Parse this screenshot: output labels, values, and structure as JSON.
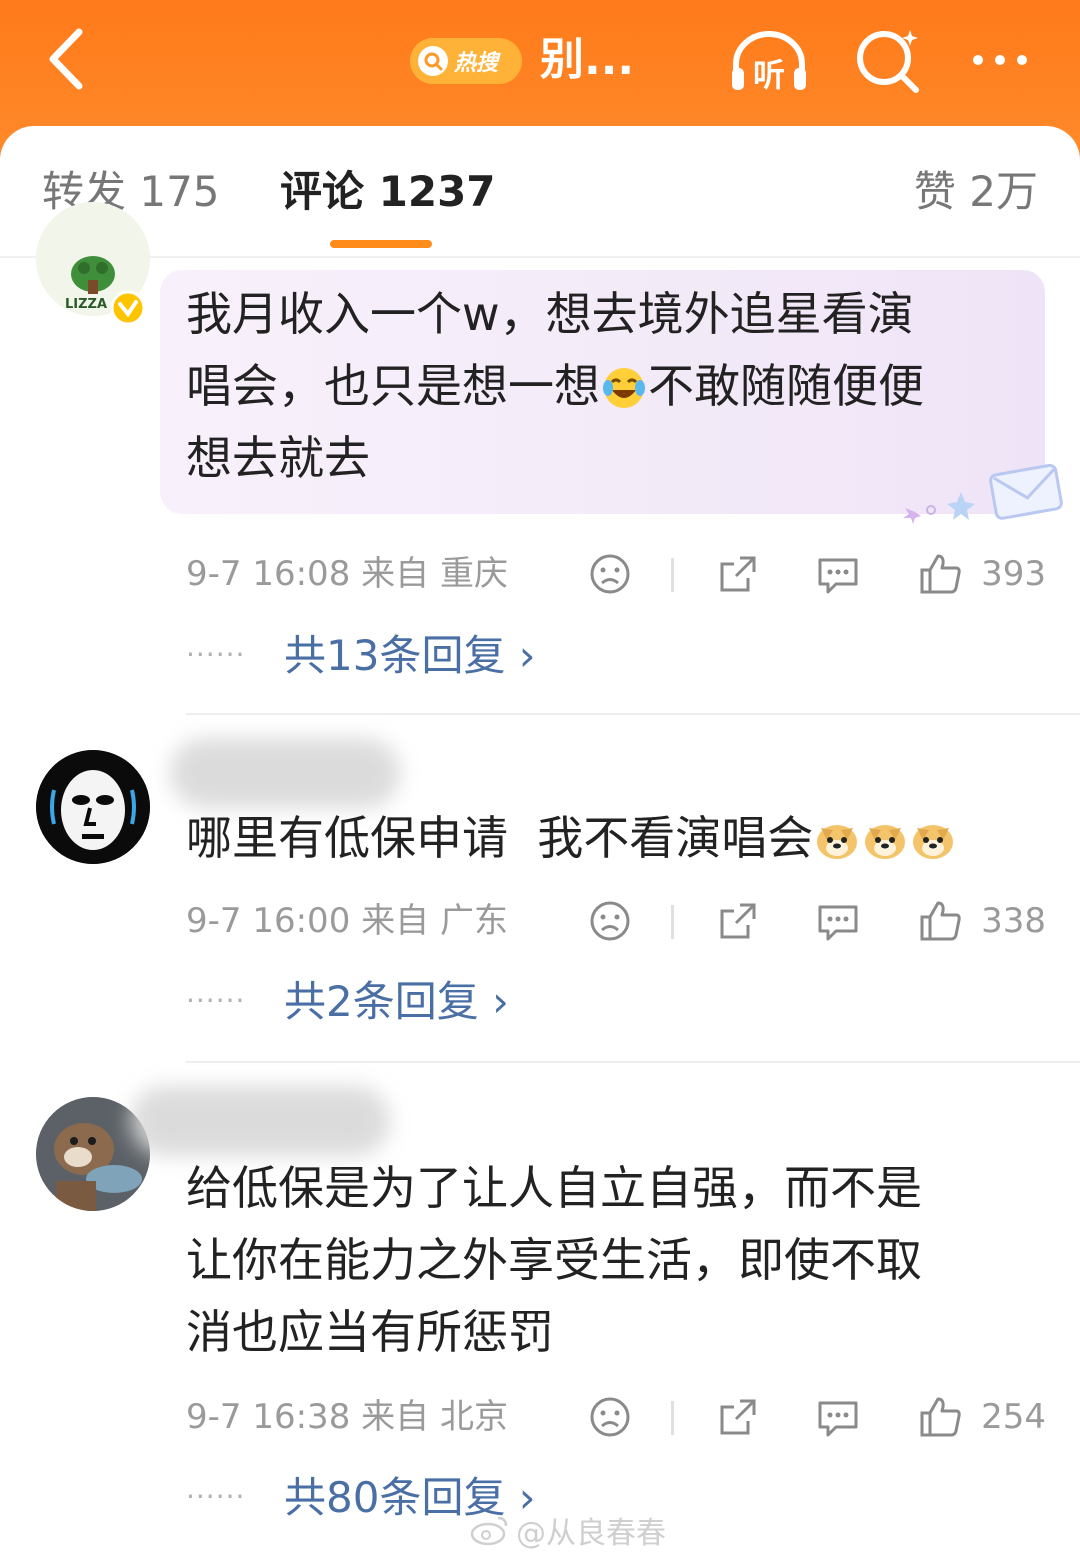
{
  "header": {
    "back_icon": "chevron-left-icon",
    "hot_badge": "热搜",
    "title": "别...",
    "listen_label": "听",
    "search_icon": "search-icon",
    "more_icon": "more-icon"
  },
  "tabs": {
    "repost": "转发 175",
    "comments": "评论 1237",
    "likes": "赞 2万"
  },
  "comments": [
    {
      "text": "我月收入一个w，想去境外追星看演唱会，也只是想一想😂不敢随随便便想去就去",
      "text_line1": "我月收入一个w，想去境外追星看演",
      "text_line2a": "唱会，也只是想一想",
      "text_line2b": "不敢随随便便",
      "text_line3": "想去就去",
      "time": "9-7 16:08",
      "from": "来自 重庆",
      "likes": "393",
      "replies": "共13条回复",
      "avatar_label": "LIZZA"
    },
    {
      "text": "哪里有低保申请  我不看演唱会",
      "time": "9-7 16:00",
      "from": "来自 广东",
      "likes": "338",
      "replies": "共2条回复"
    },
    {
      "text_line1": "给低保是为了让人自立自强，而不是",
      "text_line2": "让你在能力之外享受生活，即使不取",
      "text_line3": "消也应当有所惩罚",
      "time": "9-7 16:38",
      "from": "来自 北京",
      "likes": "254",
      "replies": "共80条回复"
    }
  ],
  "watermark": "@从良春春",
  "colors": {
    "header_orange": "#ff7a1a",
    "accent": "#ff8c1a",
    "link_blue": "#4a6fa5"
  }
}
